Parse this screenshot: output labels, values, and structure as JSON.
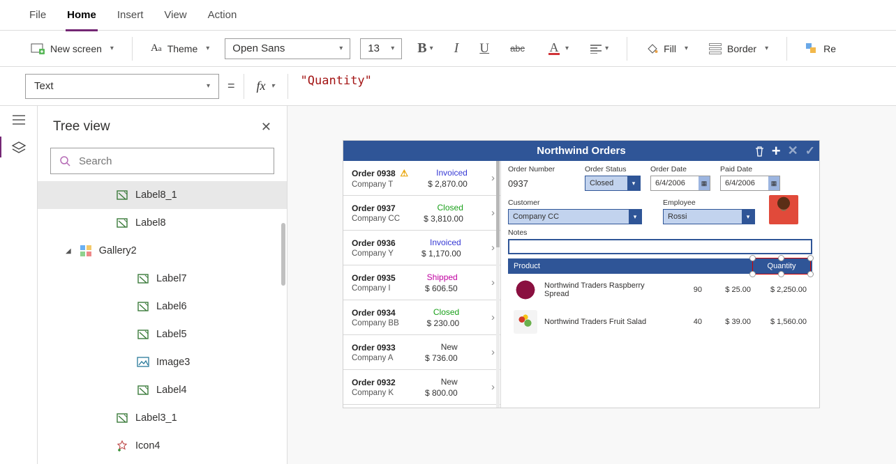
{
  "menu": {
    "items": [
      "File",
      "Home",
      "Insert",
      "View",
      "Action"
    ],
    "active": "Home"
  },
  "ribbon": {
    "new_screen": "New screen",
    "theme": "Theme",
    "font_family": "Open Sans",
    "font_size": "13",
    "fill": "Fill",
    "border": "Border",
    "reorder": "Re"
  },
  "formula": {
    "property": "Text",
    "fx": "fx",
    "expression": "\"Quantity\""
  },
  "leftrail": {
    "panel_title": "Tree view"
  },
  "tree": {
    "search_placeholder": "Search",
    "items": [
      {
        "label": "Label8_1",
        "icon": "label",
        "indent": 3,
        "selected": true
      },
      {
        "label": "Label8",
        "icon": "label",
        "indent": 3
      },
      {
        "label": "Gallery2",
        "icon": "gallery",
        "indent": 2,
        "caret": true
      },
      {
        "label": "Label7",
        "icon": "label",
        "indent": 4
      },
      {
        "label": "Label6",
        "icon": "label",
        "indent": 4
      },
      {
        "label": "Label5",
        "icon": "label",
        "indent": 4
      },
      {
        "label": "Image3",
        "icon": "image",
        "indent": 4
      },
      {
        "label": "Label4",
        "icon": "label",
        "indent": 4
      },
      {
        "label": "Label3_1",
        "icon": "label",
        "indent": 3
      },
      {
        "label": "Icon4",
        "icon": "iconctrl",
        "indent": 3
      }
    ]
  },
  "canvas": {
    "title": "Northwind Orders",
    "orders": [
      {
        "name": "Order 0938",
        "company": "Company T",
        "status": "Invoiced",
        "status_cls": "st-invoiced",
        "amount": "$ 2,870.00",
        "warn": true
      },
      {
        "name": "Order 0937",
        "company": "Company CC",
        "status": "Closed",
        "status_cls": "st-closed",
        "amount": "$ 3,810.00"
      },
      {
        "name": "Order 0936",
        "company": "Company Y",
        "status": "Invoiced",
        "status_cls": "st-invoiced",
        "amount": "$ 1,170.00"
      },
      {
        "name": "Order 0935",
        "company": "Company I",
        "status": "Shipped",
        "status_cls": "st-shipped",
        "amount": "$ 606.50"
      },
      {
        "name": "Order 0934",
        "company": "Company BB",
        "status": "Closed",
        "status_cls": "st-closed",
        "amount": "$ 230.00"
      },
      {
        "name": "Order 0933",
        "company": "Company A",
        "status": "New",
        "status_cls": "st-new",
        "amount": "$ 736.00"
      },
      {
        "name": "Order 0932",
        "company": "Company K",
        "status": "New",
        "status_cls": "st-new",
        "amount": "$ 800.00"
      }
    ],
    "detail": {
      "labels": {
        "order_number": "Order Number",
        "order_status": "Order Status",
        "order_date": "Order Date",
        "paid_date": "Paid Date",
        "customer": "Customer",
        "employee": "Employee",
        "notes": "Notes",
        "product": "Product",
        "quantity": "Quantity"
      },
      "values": {
        "order_number": "0937",
        "order_status": "Closed",
        "order_date": "6/4/2006",
        "paid_date": "6/4/2006",
        "customer": "Company CC",
        "employee": "Rossi"
      },
      "products": [
        {
          "name": "Northwind Traders Raspberry Spread",
          "qty": "90",
          "price": "$ 25.00",
          "total": "$ 2,250.00",
          "img": "berry"
        },
        {
          "name": "Northwind Traders Fruit Salad",
          "qty": "40",
          "price": "$ 39.00",
          "total": "$ 1,560.00",
          "img": "salad"
        }
      ]
    }
  }
}
